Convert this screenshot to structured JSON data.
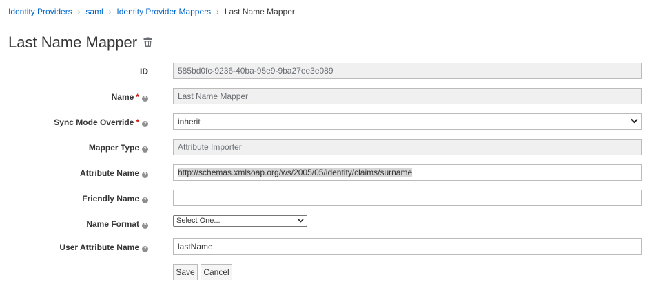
{
  "breadcrumb": {
    "items": [
      "Identity Providers",
      "saml",
      "Identity Provider Mappers"
    ],
    "current": "Last Name Mapper",
    "separator": "›"
  },
  "page": {
    "title": "Last Name Mapper"
  },
  "form": {
    "id": {
      "label": "ID",
      "value": "585bd0fc-9236-40ba-95e9-9ba27ee3e089"
    },
    "name": {
      "label": "Name",
      "required_mark": "*",
      "value": "Last Name Mapper"
    },
    "sync_mode": {
      "label": "Sync Mode Override",
      "required_mark": "*",
      "value": "inherit"
    },
    "mapper_type": {
      "label": "Mapper Type",
      "value": "Attribute Importer"
    },
    "attribute_name": {
      "label": "Attribute Name",
      "value": "http://schemas.xmlsoap.org/ws/2005/05/identity/claims/surname"
    },
    "friendly_name": {
      "label": "Friendly Name",
      "value": ""
    },
    "name_format": {
      "label": "Name Format",
      "value": "Select One..."
    },
    "user_attribute_name": {
      "label": "User Attribute Name",
      "value": "lastName"
    }
  },
  "actions": {
    "save_label": "Save",
    "cancel_label": "Cancel"
  },
  "icons": {
    "help": "?",
    "delete": "trash-icon",
    "dropdown": "chevron-down-icon"
  },
  "colors": {
    "link": "#0066cc",
    "required": "#c9190b",
    "readonly_bg": "#f0f0f0"
  }
}
